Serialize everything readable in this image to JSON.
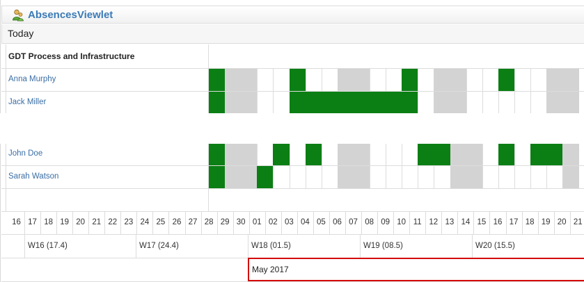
{
  "viewlet": {
    "title": "AbsencesViewlet",
    "today_label": "Today",
    "icon": "people-icon",
    "accent": "#3b7bb7"
  },
  "group": {
    "name": "GDT Process and Infrastructure"
  },
  "people": [
    "Anna Murphy",
    "Jack Miller",
    "John Doe",
    "Sarah Watson"
  ],
  "days": [
    "16",
    "17",
    "18",
    "19",
    "20",
    "21",
    "22",
    "23",
    "24",
    "25",
    "26",
    "27",
    "28",
    "29",
    "30",
    "01",
    "02",
    "03",
    "04",
    "05",
    "06",
    "07",
    "08",
    "09",
    "10",
    "11",
    "12",
    "13",
    "14",
    "15",
    "16",
    "17",
    "18",
    "19",
    "20",
    "21"
  ],
  "weeks": [
    "W16 (17.4)",
    "W17 (24.4)",
    "W18 (01.5)",
    "W19 (08.5)",
    "W20 (15.5)"
  ],
  "month": "May 2017",
  "colors": {
    "absence": "#0b7f14",
    "weekend": "#d3d3d3",
    "selection": "#d40000"
  },
  "schedule": {
    "anna_murphy": [
      "absent",
      "weekend",
      "weekend",
      "",
      "",
      "absent",
      "",
      "",
      "weekend",
      "weekend",
      "",
      "",
      "absent",
      "",
      "weekend",
      "weekend",
      "",
      "",
      "absent",
      "",
      "",
      "weekend",
      "weekend"
    ],
    "jack_miller": [
      "absent",
      "weekend",
      "weekend",
      "",
      "",
      "absent",
      "absent",
      "absent",
      "absent",
      "absent",
      "absent",
      "absent",
      "absent",
      "",
      "weekend",
      "weekend",
      "",
      "",
      "",
      "",
      "",
      "weekend",
      "weekend"
    ],
    "john_doe": [
      "absent",
      "weekend",
      "weekend",
      "",
      "absent",
      "",
      "absent",
      "",
      "weekend",
      "weekend",
      "",
      "",
      "",
      "absent",
      "absent",
      "weekend",
      "weekend",
      "",
      "absent",
      "",
      "absent",
      "absent",
      "weekend"
    ],
    "sarah_watson": [
      "absent",
      "weekend",
      "weekend",
      "absent",
      "",
      "",
      "",
      "",
      "weekend",
      "weekend",
      "",
      "",
      "",
      "",
      "",
      "weekend",
      "weekend",
      "",
      "",
      "",
      "",
      "",
      "weekend"
    ]
  }
}
